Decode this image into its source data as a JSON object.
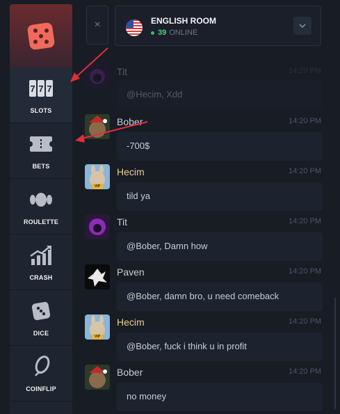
{
  "sidebar": {
    "items": [
      {
        "label": "SLOTS",
        "icon": "slot-machine-icon",
        "active": true
      },
      {
        "label": "BETS",
        "icon": "ticket-icon",
        "active": false
      },
      {
        "label": "ROULETTE",
        "icon": "roulette-icon",
        "active": false
      },
      {
        "label": "CRASH",
        "icon": "chart-up-icon",
        "active": false
      },
      {
        "label": "DICE",
        "icon": "dice-icon",
        "active": false
      },
      {
        "label": "COINFLIP",
        "icon": "coin-icon",
        "active": false
      }
    ]
  },
  "chat": {
    "close_symbol": "×",
    "room_title": "ENGLISH ROOM",
    "online_count": "39",
    "online_label": "ONLINE",
    "messages": [
      {
        "user": "Tit",
        "time": "14:20 PM",
        "text": "@Hecim, Xdd",
        "name_color": "#c8ccd4"
      },
      {
        "user": "Bober",
        "time": "14:20 PM",
        "text": "-700$",
        "name_color": "#c8ccd4"
      },
      {
        "user": "Hecim",
        "time": "14:20 PM",
        "text": "tild ya",
        "name_color": "#e8cf8f",
        "vip": "VIP"
      },
      {
        "user": "Tit",
        "time": "14:20 PM",
        "text": "@Bober, Damn how",
        "name_color": "#c8ccd4"
      },
      {
        "user": "Paven",
        "time": "14:20 PM",
        "text": "@Bober, damn bro, u need comeback",
        "name_color": "#c8ccd4"
      },
      {
        "user": "Hecim",
        "time": "14:20 PM",
        "text": "@Bober, fuck i think u in profit",
        "name_color": "#e8cf8f",
        "vip": "VIP"
      },
      {
        "user": "Bober",
        "time": "14:20 PM",
        "text": "no money",
        "name_color": "#c8ccd4"
      }
    ]
  },
  "colors": {
    "accent_red": "#e0303a",
    "online_green": "#4cd080",
    "vip_gold": "#e8b340"
  }
}
